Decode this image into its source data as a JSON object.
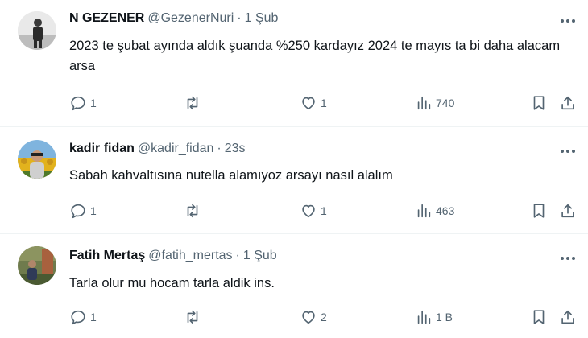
{
  "tweets": [
    {
      "name": "N GEZENER",
      "handle": "@GezenerNuri",
      "dot": "·",
      "time": "1 Şub",
      "text": "2023 te şubat ayında aldık şuanda %250 kardayız 2024 te mayıs ta bi daha alacam arsa",
      "replies": "1",
      "reposts": "",
      "likes": "1",
      "views": "740"
    },
    {
      "name": "kadir fidan",
      "handle": "@kadir_fidan",
      "dot": "·",
      "time": "23s",
      "text": "Sabah kahvaltısına nutella alamıyoz arsayı nasıl alalım",
      "replies": "1",
      "reposts": "",
      "likes": "1",
      "views": "463"
    },
    {
      "name": "Fatih Mertaş",
      "handle": "@fatih_mertas",
      "dot": "·",
      "time": "1 Şub",
      "text": "Tarla olur mu hocam tarla aldik ins.",
      "replies": "1",
      "reposts": "",
      "likes": "2",
      "views": "1 B"
    }
  ],
  "icons": {
    "reply": "reply-icon",
    "repost": "repost-icon",
    "like": "heart-icon",
    "views": "views-icon",
    "bookmark": "bookmark-icon",
    "share": "share-icon",
    "more": "more-icon"
  },
  "colors": {
    "text": "#0f1419",
    "secondary": "#536471",
    "divider": "#eff3f4"
  }
}
